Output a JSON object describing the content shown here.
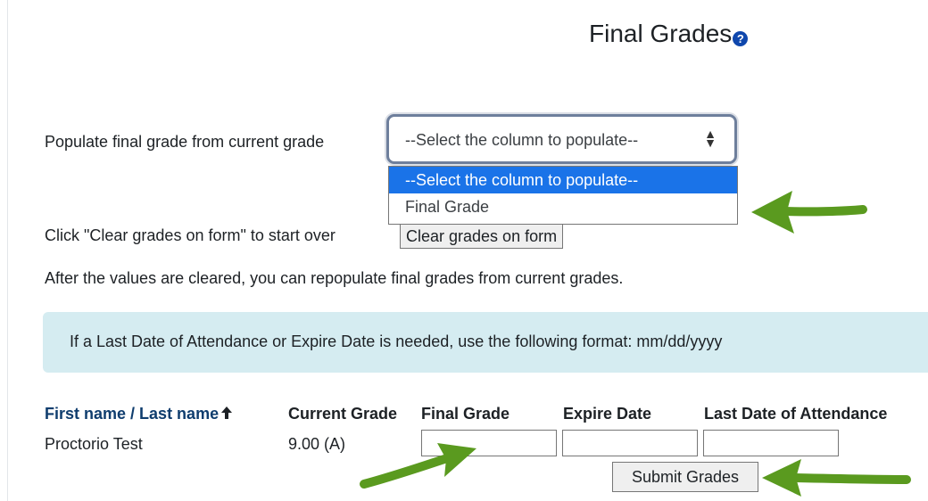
{
  "page": {
    "title": "Final Grades",
    "help_icon": "?"
  },
  "populate": {
    "label": "Populate final grade from current grade",
    "selected": "--Select the column to populate--",
    "caret": "⬍",
    "options": [
      "--Select the column to populate--",
      "Final Grade"
    ]
  },
  "clear": {
    "label": "Click \"Clear grades on form\" to start over",
    "button": "Clear grades on form"
  },
  "after_note": "After the values are cleared, you can repopulate final grades from current grades.",
  "alert": "If a Last Date of Attendance or Expire Date is needed, use the following format: mm/dd/yyyy",
  "table": {
    "headers": {
      "first_name": "First name",
      "separator": " / ",
      "last_name": "Last name",
      "sort_arrow": "🡑",
      "current_grade": "Current Grade",
      "final_grade": "Final Grade",
      "expire_date": "Expire Date",
      "last_attendance": "Last Date of Attendance"
    },
    "rows": [
      {
        "name": "Proctorio Test",
        "current_grade": "9.00 (A)",
        "final_grade": "",
        "expire_date": "",
        "last_attendance": ""
      }
    ]
  },
  "submit_button": "Submit Grades",
  "colors": {
    "arrow": "#5a9a1f",
    "link": "#0f3d6e",
    "alert_bg": "#d5ecf1",
    "select_highlight": "#1a73e8"
  }
}
